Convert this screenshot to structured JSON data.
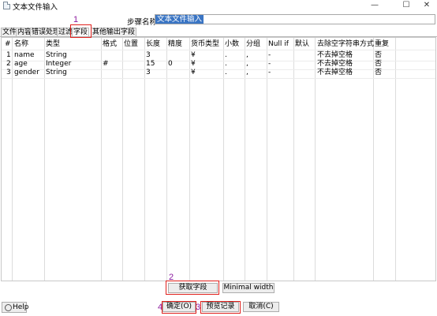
{
  "window": {
    "title": "文本文件输入",
    "minimize_glyph": "—",
    "maximize_glyph": "☐",
    "close_glyph": "✕"
  },
  "step": {
    "label": "步骤名称",
    "value": "文本文件输入"
  },
  "tabs": [
    {
      "label": "文件"
    },
    {
      "label": "内容"
    },
    {
      "label": "错误处理"
    },
    {
      "label": "过滤"
    },
    {
      "label": "字段"
    },
    {
      "label": "其他输出字段"
    }
  ],
  "table": {
    "headers": [
      "#",
      "名称",
      "类型",
      "格式",
      "位置",
      "长度",
      "精度",
      "货币类型",
      "小数",
      "分组",
      "Null if",
      "默认",
      "去除空字符串方式",
      "重复"
    ],
    "rows": [
      [
        "1",
        "name",
        "String",
        "",
        "",
        "3",
        "",
        "¥",
        ".",
        ",",
        "-",
        "",
        "不去掉空格",
        "否"
      ],
      [
        "2",
        "age",
        "Integer",
        "#",
        "",
        "15",
        "0",
        "¥",
        ".",
        ",",
        "-",
        "",
        "不去掉空格",
        "否"
      ],
      [
        "3",
        "gender",
        "String",
        "",
        "",
        "3",
        "",
        "¥",
        ".",
        ",",
        "-",
        "",
        "不去掉空格",
        "否"
      ]
    ]
  },
  "buttons": {
    "get_fields": "获取字段",
    "minimal_width": "Minimal width",
    "help": "Help",
    "ok": "确定(O)",
    "preview": "预览记录",
    "cancel": "取消(C)"
  },
  "annotations": {
    "tab": "1",
    "get_fields": "2",
    "preview": "3",
    "ok": "4"
  },
  "colors": {
    "annotation": "#8b1a9e",
    "highlight_box": "#e0201c",
    "selection": "#3a75c4"
  },
  "icons": [
    "app-icon",
    "minimize-icon",
    "maximize-icon",
    "close-icon",
    "help-icon"
  ]
}
